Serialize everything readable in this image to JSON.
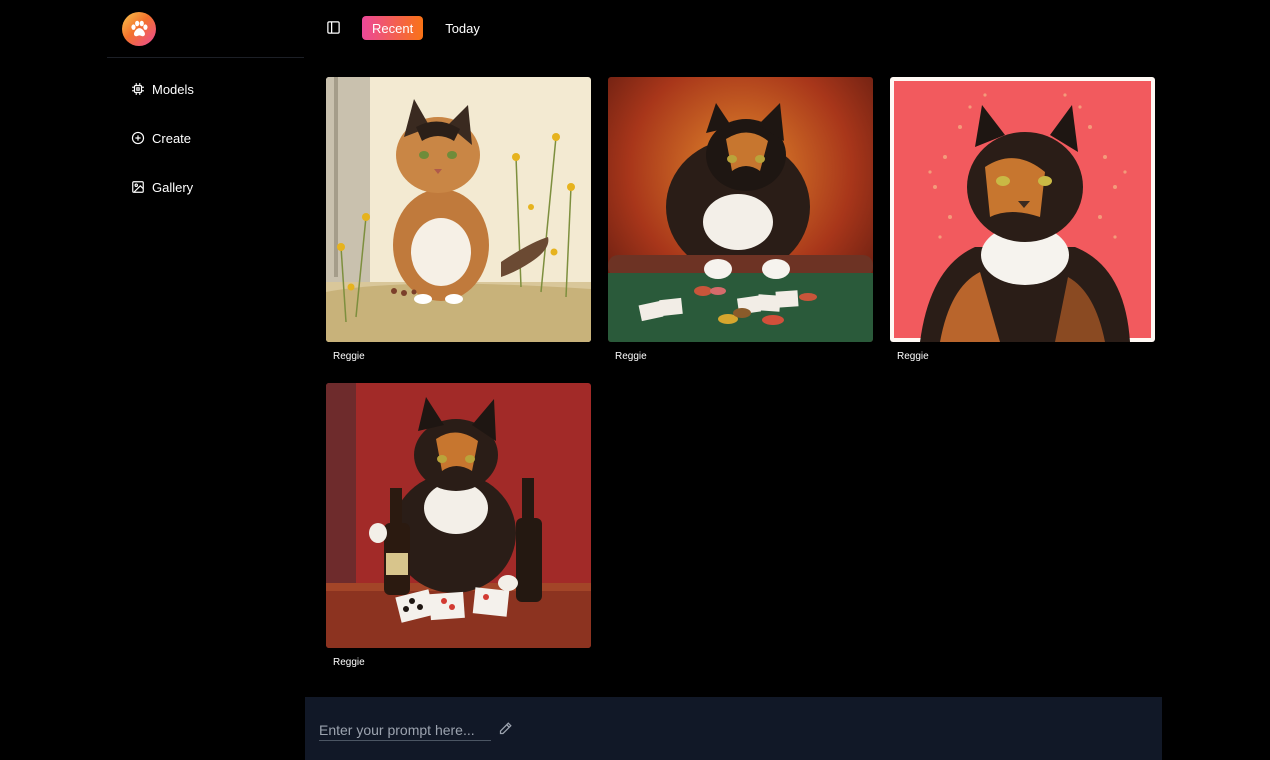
{
  "app": {
    "logo_icon": "paw-icon",
    "brand_gradient": [
      "#f9c74f",
      "#f3722c",
      "#ec4899"
    ]
  },
  "sidebar": {
    "items": [
      {
        "label": "Models",
        "icon": "chip-icon"
      },
      {
        "label": "Create",
        "icon": "plus-circle-icon"
      },
      {
        "label": "Gallery",
        "icon": "image-icon"
      }
    ]
  },
  "header": {
    "toggle_icon": "sidebar-toggle-icon",
    "tabs": [
      {
        "label": "Recent",
        "active": true
      },
      {
        "label": "Today",
        "active": false
      }
    ]
  },
  "gallery": {
    "items": [
      {
        "caption": "Reggie"
      },
      {
        "caption": "Reggie"
      },
      {
        "caption": "Reggie"
      },
      {
        "caption": "Reggie"
      }
    ]
  },
  "prompt": {
    "placeholder": "Enter your prompt here...",
    "value": "",
    "icon": "pencil-icon"
  },
  "colors": {
    "background": "#000000",
    "prompt_bar": "#111827",
    "accent_start": "#ec4899",
    "accent_end": "#f97316"
  }
}
